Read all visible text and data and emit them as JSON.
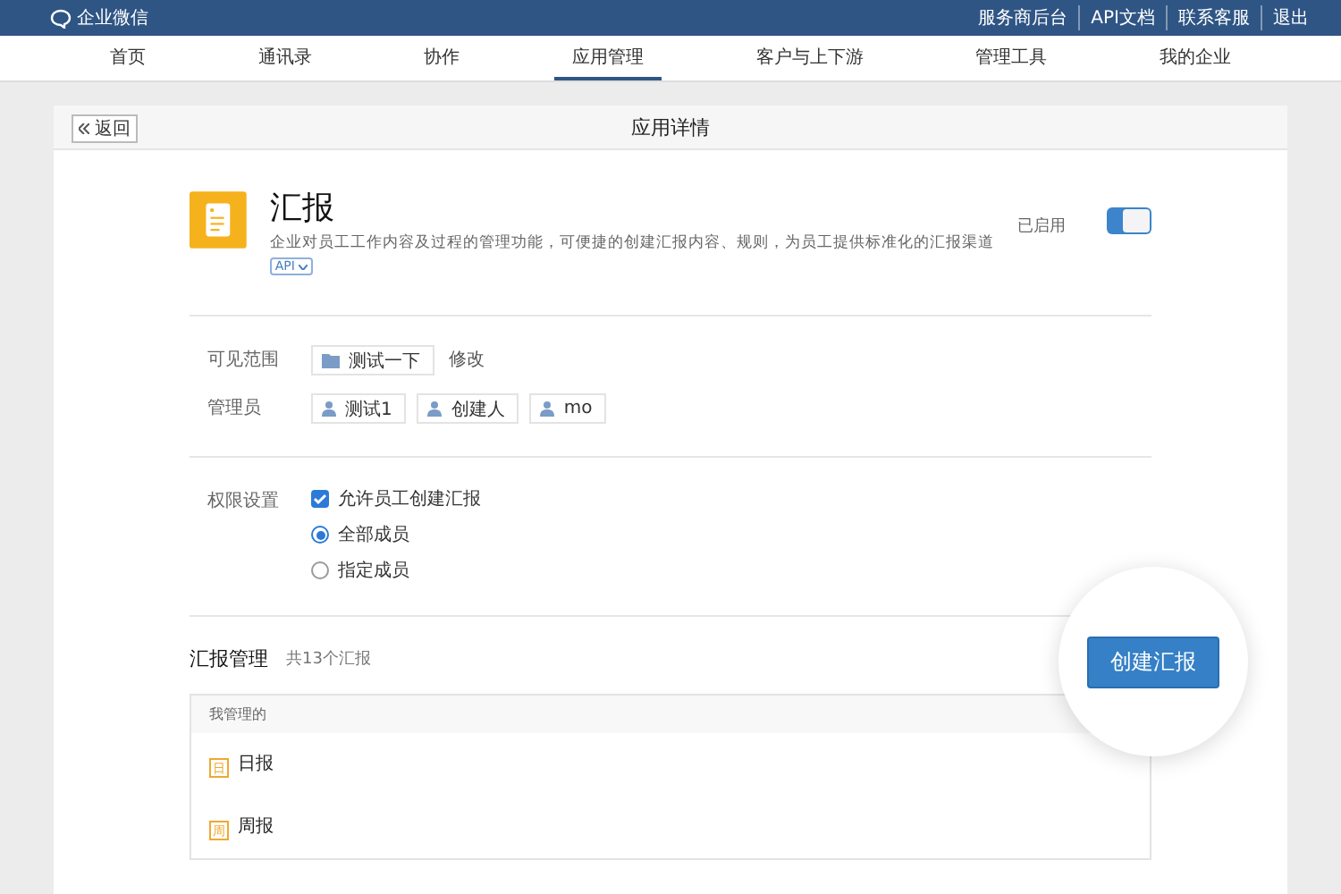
{
  "topbar": {
    "logo": "企业微信",
    "links": [
      "服务商后台",
      "API文档",
      "联系客服",
      "退出"
    ]
  },
  "nav": [
    {
      "label": "首页",
      "selected": false
    },
    {
      "label": "通讯录",
      "selected": false
    },
    {
      "label": "协作",
      "selected": false
    },
    {
      "label": "应用管理",
      "selected": true
    },
    {
      "label": "客户与上下游",
      "selected": false
    },
    {
      "label": "管理工具",
      "selected": false
    },
    {
      "label": "我的企业",
      "selected": false
    }
  ],
  "page": {
    "back": "返回",
    "title": "应用详情"
  },
  "app": {
    "name": "汇报",
    "description": "企业对员工工作内容及过程的管理功能，可便捷的创建汇报内容、规则，为员工提供标准化的汇报渠道",
    "api_badge": "API",
    "status": "已启用",
    "on": true
  },
  "scope": {
    "label": "可见范围",
    "department": "测试一下",
    "edit": "修改"
  },
  "admins": {
    "label": "管理员",
    "people": [
      "测试1",
      "创建人",
      "mo"
    ]
  },
  "permissions": {
    "label": "权限设置",
    "allow": {
      "label": "允许员工创建汇报",
      "checked": true
    },
    "options": [
      {
        "label": "全部成员",
        "selected": true
      },
      {
        "label": "指定成员",
        "selected": false
      }
    ]
  },
  "reports": {
    "title": "汇报管理",
    "count": "共13个汇报",
    "create": "创建汇报",
    "group": "我管理的",
    "items": [
      {
        "icon_char": "日",
        "name": "日报"
      },
      {
        "icon_char": "周",
        "name": "周报"
      }
    ]
  }
}
